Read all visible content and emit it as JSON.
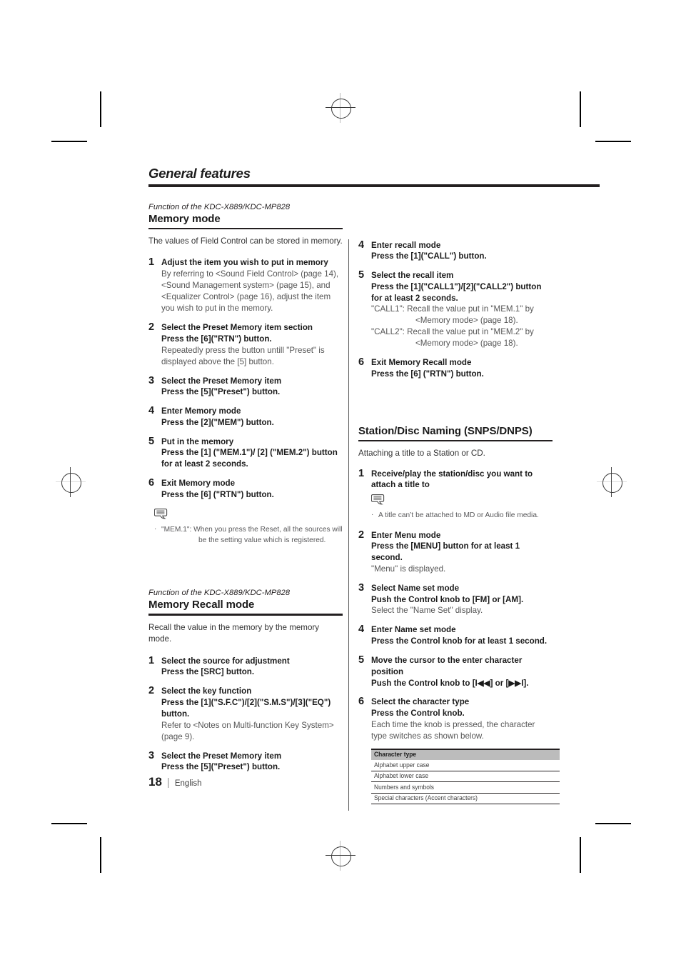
{
  "document": {
    "title": "General features",
    "footer": {
      "page_number": "18",
      "separator": "|",
      "language": "English"
    }
  },
  "left_column": {
    "section1": {
      "function_line": "Function of the KDC-X889/KDC-MP828",
      "heading": "Memory mode",
      "intro": "The values of Field Control can be stored in memory.",
      "steps": [
        {
          "num": "1",
          "bold": "Adjust the item you wish to put in memory",
          "normal": "By referring to <Sound Field Control> (page 14), <Sound Management system> (page 15), and <Equalizer Control> (page 16), adjust the item you wish to put in the memory."
        },
        {
          "num": "2",
          "bold": "Select the Preset Memory item section",
          "bold2": "Press the [6](\"RTN\") button.",
          "normal": "Repeatedly press the button untill \"Preset\" is displayed above the [5] button."
        },
        {
          "num": "3",
          "bold": "Select the Preset Memory item",
          "bold2": "Press the [5](\"Preset\") button."
        },
        {
          "num": "4",
          "bold": "Enter Memory mode",
          "bold2": "Press the [2](\"MEM\") button."
        },
        {
          "num": "5",
          "bold": "Put in the memory",
          "bold2": "Press the [1] (\"MEM.1\")/ [2] (\"MEM.2\") button for at least 2 seconds."
        },
        {
          "num": "6",
          "bold": "Exit Memory mode",
          "bold2": "Press the [6] (\"RTN\") button."
        }
      ],
      "note": {
        "icon": "note-bubble-icon",
        "bullet": "·",
        "line1": "\"MEM.1\": When you press the Reset, all the sources will",
        "line2": "be the setting value which is registered."
      }
    },
    "section2": {
      "function_line": "Function of the KDC-X889/KDC-MP828",
      "heading": "Memory Recall mode",
      "intro": "Recall the value in the memory by the memory mode.",
      "steps": [
        {
          "num": "1",
          "bold": "Select the source for adjustment",
          "bold2": "Press the [SRC] button."
        },
        {
          "num": "2",
          "bold": "Select the key function",
          "bold2": "Press the [1](\"S.F.C\")/[2](\"S.M.S\")/[3](\"EQ\") button.",
          "normal": "Refer to <Notes on Multi-function Key System> (page 9)."
        },
        {
          "num": "3",
          "bold": "Select the Preset Memory item",
          "bold2": "Press the [5](\"Preset\") button."
        }
      ]
    }
  },
  "right_column": {
    "continued_steps": [
      {
        "num": "4",
        "bold": "Enter recall mode",
        "bold2": "Press the [1](\"CALL\") button."
      },
      {
        "num": "5",
        "bold": "Select the recall item",
        "bold2": "Press the [1](\"CALL1\")/[2](\"CALL2\") button for at least 2 seconds.",
        "note_a1": "\"CALL1\": Recall the value put in \"MEM.1\" by",
        "note_a2": "<Memory mode> (page 18).",
        "note_b1": "\"CALL2\": Recall the value put in \"MEM.2\" by",
        "note_b2": "<Memory mode> (page 18)."
      },
      {
        "num": "6",
        "bold": "Exit Memory Recall mode",
        "bold2": "Press the [6] (\"RTN\") button."
      }
    ],
    "section3": {
      "heading": "Station/Disc Naming (SNPS/DNPS)",
      "intro": "Attaching a title to a Station or CD.",
      "steps": [
        {
          "num": "1",
          "bold": "Receive/play the station/disc you want to attach a title to"
        },
        {
          "num": "2",
          "bold": "Enter Menu mode",
          "bold2": "Press the [MENU] button for at least 1 second.",
          "normal": "\"Menu\" is displayed."
        },
        {
          "num": "3",
          "bold": "Select Name set mode",
          "bold2": "Push the Control knob to [FM] or [AM].",
          "normal": "Select the \"Name Set\" display."
        },
        {
          "num": "4",
          "bold": "Enter Name set mode",
          "bold2": "Press the Control knob for at least 1 second."
        },
        {
          "num": "5",
          "bold": "Move the cursor to the enter character position",
          "bold2": "Push the Control knob to [I◀◀] or [▶▶I]."
        },
        {
          "num": "6",
          "bold": "Select the character type",
          "bold2": "Press the Control knob.",
          "normal": "Each time the knob is pressed, the character type switches as shown below."
        }
      ],
      "note": {
        "icon": "note-bubble-icon",
        "bullet": "·",
        "line1": "A title can’t be attached to MD or Audio file media."
      },
      "character_table": {
        "header": "Character type",
        "rows": [
          "Alphabet upper case",
          "Alphabet lower case",
          "Numbers and symbols",
          "Special characters (Accent characters)"
        ]
      }
    }
  },
  "colors": {
    "text": "#231f20",
    "grey_text": "#58585a",
    "rule": "#231f20",
    "table_header_bg": "#bcbcbc"
  }
}
